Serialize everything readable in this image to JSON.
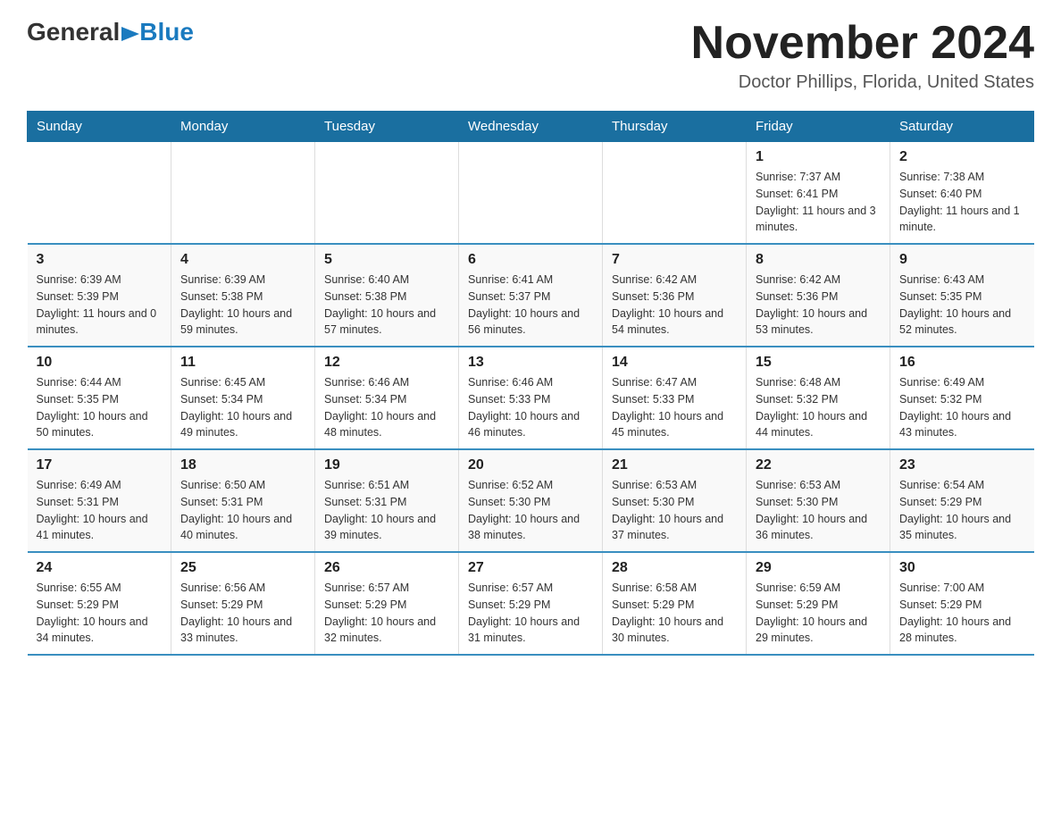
{
  "logo": {
    "general": "General",
    "blue": "Blue"
  },
  "title": "November 2024",
  "location": "Doctor Phillips, Florida, United States",
  "days_of_week": [
    "Sunday",
    "Monday",
    "Tuesday",
    "Wednesday",
    "Thursday",
    "Friday",
    "Saturday"
  ],
  "weeks": [
    [
      {
        "num": "",
        "info": ""
      },
      {
        "num": "",
        "info": ""
      },
      {
        "num": "",
        "info": ""
      },
      {
        "num": "",
        "info": ""
      },
      {
        "num": "",
        "info": ""
      },
      {
        "num": "1",
        "info": "Sunrise: 7:37 AM\nSunset: 6:41 PM\nDaylight: 11 hours and 3 minutes."
      },
      {
        "num": "2",
        "info": "Sunrise: 7:38 AM\nSunset: 6:40 PM\nDaylight: 11 hours and 1 minute."
      }
    ],
    [
      {
        "num": "3",
        "info": "Sunrise: 6:39 AM\nSunset: 5:39 PM\nDaylight: 11 hours and 0 minutes."
      },
      {
        "num": "4",
        "info": "Sunrise: 6:39 AM\nSunset: 5:38 PM\nDaylight: 10 hours and 59 minutes."
      },
      {
        "num": "5",
        "info": "Sunrise: 6:40 AM\nSunset: 5:38 PM\nDaylight: 10 hours and 57 minutes."
      },
      {
        "num": "6",
        "info": "Sunrise: 6:41 AM\nSunset: 5:37 PM\nDaylight: 10 hours and 56 minutes."
      },
      {
        "num": "7",
        "info": "Sunrise: 6:42 AM\nSunset: 5:36 PM\nDaylight: 10 hours and 54 minutes."
      },
      {
        "num": "8",
        "info": "Sunrise: 6:42 AM\nSunset: 5:36 PM\nDaylight: 10 hours and 53 minutes."
      },
      {
        "num": "9",
        "info": "Sunrise: 6:43 AM\nSunset: 5:35 PM\nDaylight: 10 hours and 52 minutes."
      }
    ],
    [
      {
        "num": "10",
        "info": "Sunrise: 6:44 AM\nSunset: 5:35 PM\nDaylight: 10 hours and 50 minutes."
      },
      {
        "num": "11",
        "info": "Sunrise: 6:45 AM\nSunset: 5:34 PM\nDaylight: 10 hours and 49 minutes."
      },
      {
        "num": "12",
        "info": "Sunrise: 6:46 AM\nSunset: 5:34 PM\nDaylight: 10 hours and 48 minutes."
      },
      {
        "num": "13",
        "info": "Sunrise: 6:46 AM\nSunset: 5:33 PM\nDaylight: 10 hours and 46 minutes."
      },
      {
        "num": "14",
        "info": "Sunrise: 6:47 AM\nSunset: 5:33 PM\nDaylight: 10 hours and 45 minutes."
      },
      {
        "num": "15",
        "info": "Sunrise: 6:48 AM\nSunset: 5:32 PM\nDaylight: 10 hours and 44 minutes."
      },
      {
        "num": "16",
        "info": "Sunrise: 6:49 AM\nSunset: 5:32 PM\nDaylight: 10 hours and 43 minutes."
      }
    ],
    [
      {
        "num": "17",
        "info": "Sunrise: 6:49 AM\nSunset: 5:31 PM\nDaylight: 10 hours and 41 minutes."
      },
      {
        "num": "18",
        "info": "Sunrise: 6:50 AM\nSunset: 5:31 PM\nDaylight: 10 hours and 40 minutes."
      },
      {
        "num": "19",
        "info": "Sunrise: 6:51 AM\nSunset: 5:31 PM\nDaylight: 10 hours and 39 minutes."
      },
      {
        "num": "20",
        "info": "Sunrise: 6:52 AM\nSunset: 5:30 PM\nDaylight: 10 hours and 38 minutes."
      },
      {
        "num": "21",
        "info": "Sunrise: 6:53 AM\nSunset: 5:30 PM\nDaylight: 10 hours and 37 minutes."
      },
      {
        "num": "22",
        "info": "Sunrise: 6:53 AM\nSunset: 5:30 PM\nDaylight: 10 hours and 36 minutes."
      },
      {
        "num": "23",
        "info": "Sunrise: 6:54 AM\nSunset: 5:29 PM\nDaylight: 10 hours and 35 minutes."
      }
    ],
    [
      {
        "num": "24",
        "info": "Sunrise: 6:55 AM\nSunset: 5:29 PM\nDaylight: 10 hours and 34 minutes."
      },
      {
        "num": "25",
        "info": "Sunrise: 6:56 AM\nSunset: 5:29 PM\nDaylight: 10 hours and 33 minutes."
      },
      {
        "num": "26",
        "info": "Sunrise: 6:57 AM\nSunset: 5:29 PM\nDaylight: 10 hours and 32 minutes."
      },
      {
        "num": "27",
        "info": "Sunrise: 6:57 AM\nSunset: 5:29 PM\nDaylight: 10 hours and 31 minutes."
      },
      {
        "num": "28",
        "info": "Sunrise: 6:58 AM\nSunset: 5:29 PM\nDaylight: 10 hours and 30 minutes."
      },
      {
        "num": "29",
        "info": "Sunrise: 6:59 AM\nSunset: 5:29 PM\nDaylight: 10 hours and 29 minutes."
      },
      {
        "num": "30",
        "info": "Sunrise: 7:00 AM\nSunset: 5:29 PM\nDaylight: 10 hours and 28 minutes."
      }
    ]
  ]
}
